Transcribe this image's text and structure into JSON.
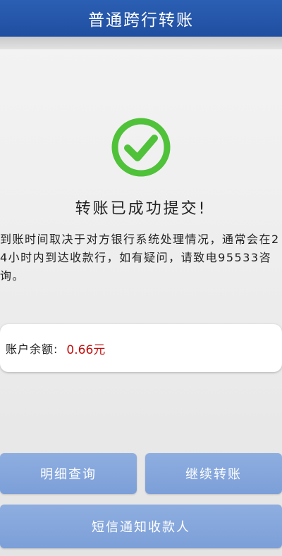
{
  "header": {
    "title": "普通跨行转账"
  },
  "result": {
    "icon": "check-circle-icon",
    "icon_color": "#4fc23a",
    "title": "转账已成功提交!",
    "notice": "到账时间取决于对方银行系统处理情况，通常会在24小时内到达收款行，如有疑问，请致电95533咨询。"
  },
  "balance": {
    "label": "账户余额:",
    "value": "0.66元",
    "value_color": "#c10f0f"
  },
  "buttons": {
    "detail_label": "明细查询",
    "continue_label": "继续转账",
    "sms_label": "短信通知收款人",
    "color": "#7c9fd8"
  },
  "colors": {
    "header": "#1f4ea0"
  }
}
